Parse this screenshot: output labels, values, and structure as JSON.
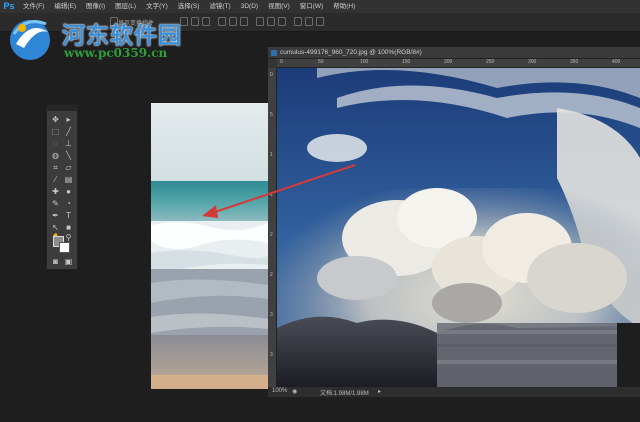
{
  "app": {
    "logo": "Ps"
  },
  "menubar": {
    "items": [
      "文件(F)",
      "编辑(E)",
      "图像(I)",
      "图层(L)",
      "文字(Y)",
      "选择(S)",
      "滤镜(T)",
      "3D(D)",
      "视图(V)",
      "窗口(W)",
      "帮助(H)"
    ]
  },
  "options": {
    "label": "显示变换控件"
  },
  "watermark": {
    "title": "河东软件园",
    "url": "www.pc0359.cn"
  },
  "document2": {
    "tab_title": "cumulus-499176_960_720.jpg @ 100%(RGB/8#)",
    "zoom": "100%",
    "doc_info": "文档:1.98M/1.98M",
    "ruler_h": [
      "0",
      "50",
      "100",
      "150",
      "200",
      "250",
      "300",
      "350",
      "400"
    ],
    "ruler_v": [
      "0",
      "5",
      "1",
      "1",
      "2",
      "2",
      "3",
      "3"
    ]
  },
  "colors": {
    "accent": "#31a8ff",
    "watermark_blue": "#3b8ed8",
    "watermark_green": "#2e9e3a",
    "arrow": "#d33a3a"
  }
}
